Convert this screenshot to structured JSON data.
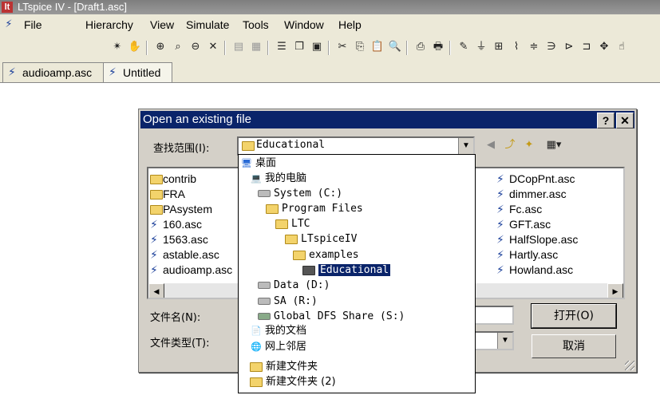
{
  "app": {
    "title": "LTspice IV - [Draft1.asc]",
    "icon": "ltspice-app-icon"
  },
  "menu": {
    "items": [
      "File",
      "Hierarchy",
      "View",
      "Simulate",
      "Tools",
      "Window",
      "Help"
    ]
  },
  "tabs": [
    {
      "label": "audioamp.asc",
      "active": false
    },
    {
      "label": "Untitled",
      "active": true
    }
  ],
  "dialog": {
    "title": "Open an existing file",
    "help_label": "?",
    "close_label": "✕",
    "look_in_label": "查找范围(I):",
    "look_in_value": "Educational",
    "filename_label": "文件名(N):",
    "filetype_label": "文件类型(T):",
    "open_button": "打开(O)",
    "cancel_button": "取消",
    "files_left": [
      {
        "name": "contrib",
        "type": "folder"
      },
      {
        "name": "FRA",
        "type": "folder"
      },
      {
        "name": "PAsystem",
        "type": "folder"
      },
      {
        "name": "160.asc",
        "type": "asc"
      },
      {
        "name": "1563.asc",
        "type": "asc"
      },
      {
        "name": "astable.asc",
        "type": "asc"
      },
      {
        "name": "audioamp.asc",
        "type": "asc"
      }
    ],
    "files_right": [
      {
        "name": "DCopPnt.asc",
        "type": "asc"
      },
      {
        "name": "dimmer.asc",
        "type": "asc"
      },
      {
        "name": "Fc.asc",
        "type": "asc"
      },
      {
        "name": "GFT.asc",
        "type": "asc"
      },
      {
        "name": "HalfSlope.asc",
        "type": "asc"
      },
      {
        "name": "Hartly.asc",
        "type": "asc"
      },
      {
        "name": "Howland.asc",
        "type": "asc"
      }
    ]
  },
  "dropdown": {
    "items": [
      {
        "label": "桌面",
        "icon": "desktop-icon"
      },
      {
        "label": "我的电脑",
        "icon": "my-computer-icon"
      },
      {
        "label": "System (C:)",
        "icon": "drive-icon"
      },
      {
        "label": "Program Files",
        "icon": "folder-icon"
      },
      {
        "label": "LTC",
        "icon": "folder-icon"
      },
      {
        "label": "LTspiceIV",
        "icon": "folder-icon"
      },
      {
        "label": "examples",
        "icon": "folder-icon"
      },
      {
        "label": "Educational",
        "icon": "open-folder-icon",
        "selected": true
      },
      {
        "label": "Data (D:)",
        "icon": "drive-icon"
      },
      {
        "label": "SA (R:)",
        "icon": "drive-icon"
      },
      {
        "label": "Global DFS Share (S:)",
        "icon": "network-drive-icon"
      },
      {
        "label": "我的文档",
        "icon": "my-documents-icon"
      },
      {
        "label": "网上邻居",
        "icon": "network-places-icon"
      },
      {
        "label": "新建文件夹",
        "icon": "folder-icon"
      },
      {
        "label": "新建文件夹 (2)",
        "icon": "folder-icon"
      }
    ]
  },
  "colors": {
    "title_bar": "#0a246a",
    "dialog_bg": "#d4d0c8",
    "selection": "#0a246a"
  }
}
